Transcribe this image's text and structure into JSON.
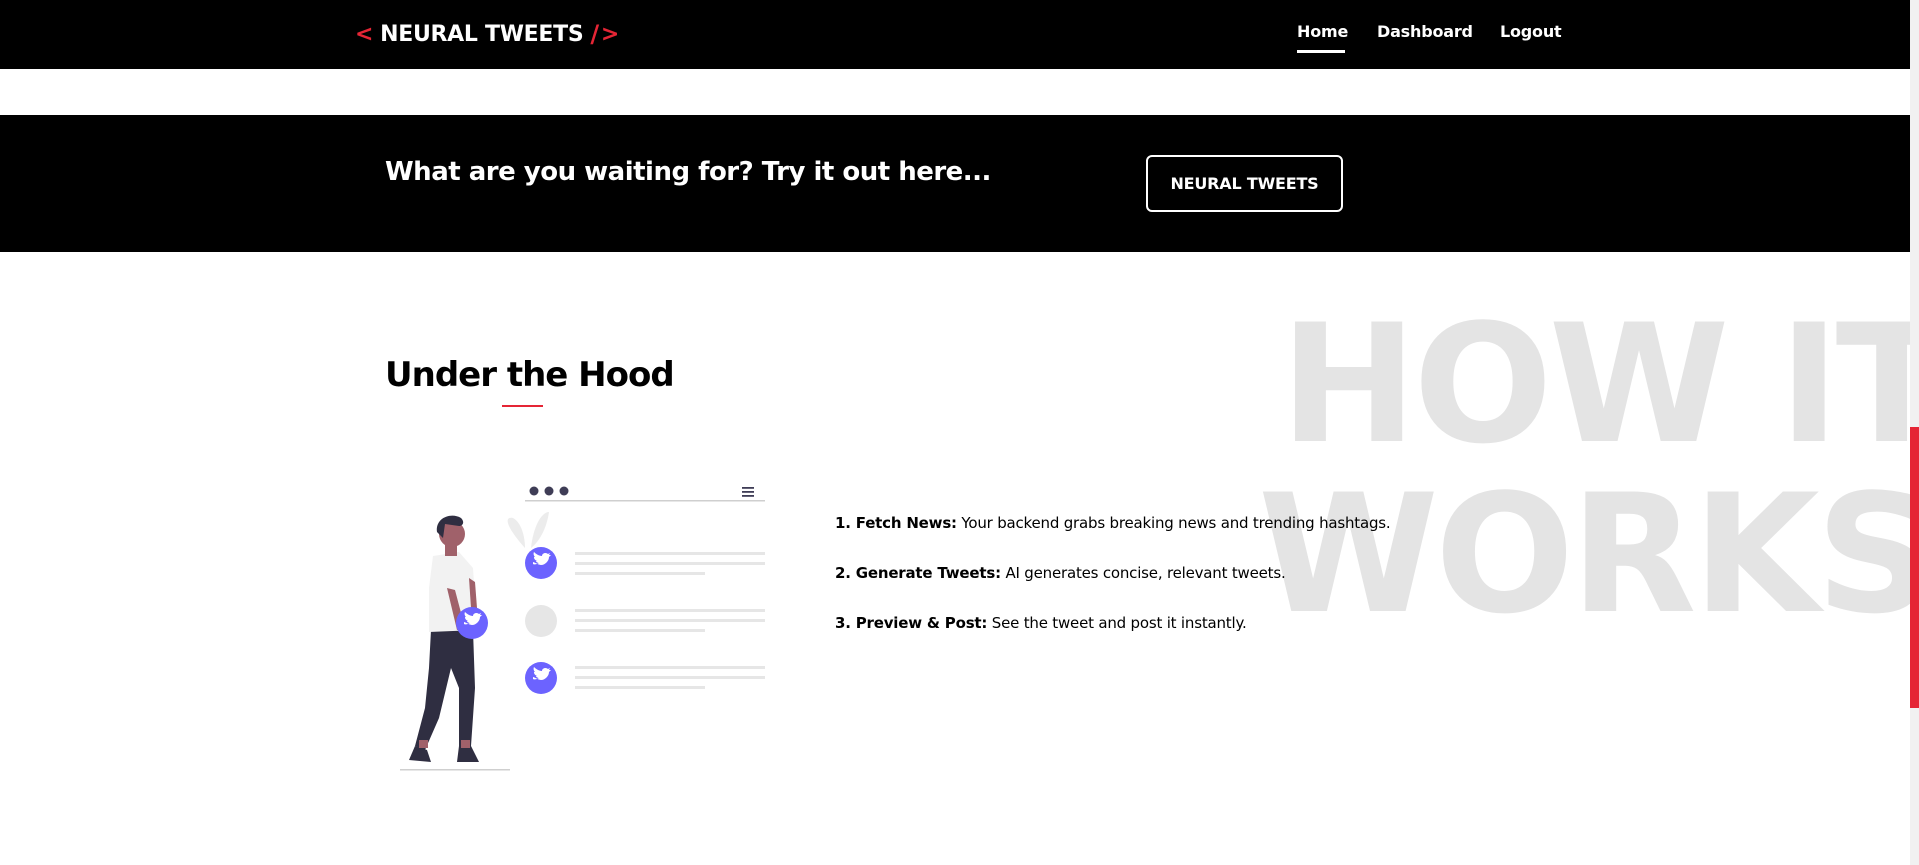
{
  "navbar": {
    "brand": {
      "open_bracket": "<",
      "name": "NEURAL TWEETS",
      "slash": "/",
      "close_bracket": ">"
    },
    "links": {
      "home": "Home",
      "dashboard": "Dashboard",
      "logout": "Logout"
    },
    "active_link": "Home"
  },
  "cta": {
    "text": "What are you waiting for? Try it out here...",
    "button_label": "NEURAL TWEETS"
  },
  "watermark": {
    "line1": "HOW IT",
    "line2": "WORKS"
  },
  "section": {
    "title": "Under the Hood",
    "steps": [
      {
        "label": "1. Fetch News:",
        "text": " Your backend grabs breaking news and trending hashtags."
      },
      {
        "label": "2. Generate Tweets:",
        "text": " AI generates concise, relevant tweets."
      },
      {
        "label": "3. Preview & Post:",
        "text": " See the tweet and post it instantly."
      }
    ]
  },
  "illustration": {
    "icons": [
      "twitter-bird-icon",
      "twitter-bird-icon",
      "twitter-bird-icon",
      "twitter-bird-icon"
    ]
  },
  "colors": {
    "accent": "#e52535",
    "background_dark": "#000000",
    "watermark": "#e4e4e4",
    "twitter_badge": "#6c63ff"
  }
}
